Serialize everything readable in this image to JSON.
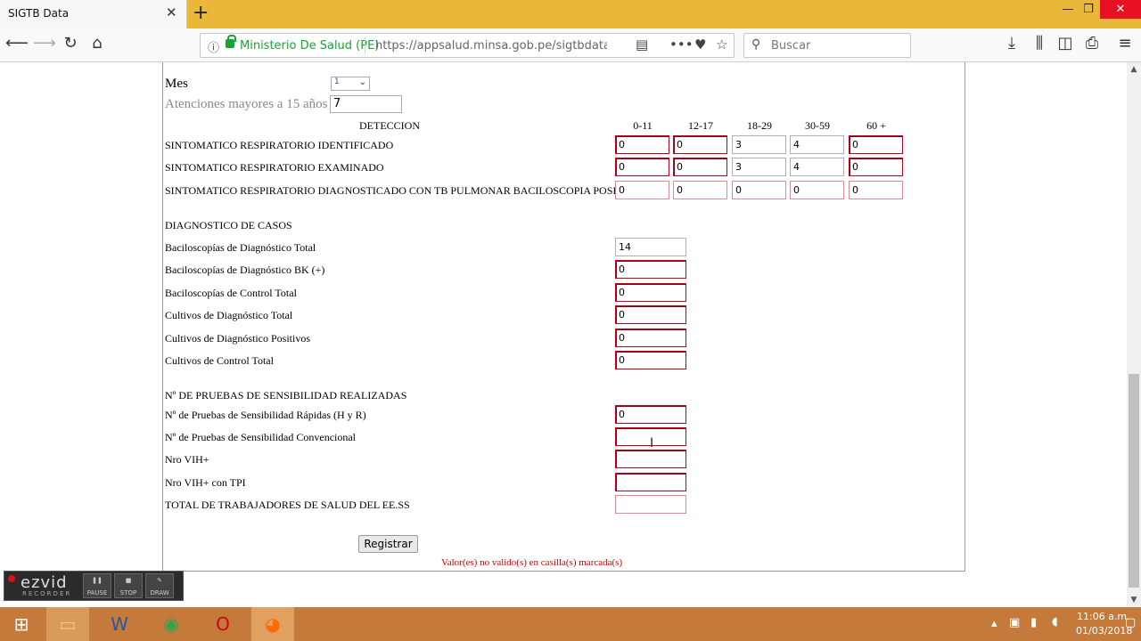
{
  "browser": {
    "tab_title": "SIGTB Data",
    "tab_close": "✕",
    "new_tab": "+",
    "site_owner": "Ministerio De Salud (PE)",
    "url": "https://appsalud.minsa.gob.pe/sigtbdata/TBC",
    "search_placeholder": "Buscar",
    "win_min": "—",
    "win_restore": "❐",
    "win_close": "✕",
    "accent_color": "#e9b83a"
  },
  "form": {
    "mes_label": "Mes",
    "mes_value": "1",
    "aten_label": "Atenciones mayores a 15 años",
    "aten_value": "7",
    "deteccion_header": "DETECCION",
    "age_columns": [
      "0-11",
      "12-17",
      "18-29",
      "30-59",
      "60 +"
    ],
    "rows": [
      {
        "label": "SINTOMATICO RESPIRATORIO IDENTIFICADO",
        "values": [
          "0",
          "0",
          "3",
          "4",
          "0"
        ]
      },
      {
        "label": "SINTOMATICO RESPIRATORIO EXAMINADO",
        "values": [
          "0",
          "0",
          "3",
          "4",
          "0"
        ]
      },
      {
        "label": "SINTOMATICO RESPIRATORIO DIAGNOSTICADO CON TB PULMONAR BACILOSCOPIA POSITIVA",
        "values": [
          "0",
          "0",
          "0",
          "0",
          "0"
        ]
      }
    ],
    "diag_header": "DIAGNOSTICO DE CASOS",
    "diag_rows": [
      {
        "label": "Baciloscopías de Diagnóstico Total",
        "value": "14"
      },
      {
        "label": "Baciloscopías de Diagnóstico BK (+)",
        "value": "0"
      },
      {
        "label": "Baciloscopías de Control Total",
        "value": "0"
      },
      {
        "label": "Cultivos de Diagnóstico Total",
        "value": "0"
      },
      {
        "label": "Cultivos de Diagnóstico Positivos",
        "value": "0"
      },
      {
        "label": "Cultivos de Control Total",
        "value": "0"
      }
    ],
    "sens_header": "Nº DE PRUEBAS DE SENSIBILIDAD REALIZADAS",
    "sens_rows": [
      {
        "label": "Nº de Pruebas de Sensibilidad Rápidas (H y R)",
        "value": "0"
      },
      {
        "label": "Nº de Pruebas de Sensibilidad Convencional",
        "value": ""
      },
      {
        "label": "Nro VIH+",
        "value": ""
      },
      {
        "label": "Nro VIH+ con TPI",
        "value": ""
      },
      {
        "label": "TOTAL DE TRABAJADORES DE SALUD DEL EE.SS",
        "value": ""
      }
    ],
    "submit_label": "Registrar",
    "error_message": "Valor(es) no valido(s) en casilla(s) marcada(s)",
    "error_color": "#d40000"
  },
  "ezvid": {
    "logo": "ezvid",
    "sub": "RECORDER",
    "pause": "PAUSE",
    "stop": "STOP",
    "draw": "DRAW"
  },
  "taskbar": {
    "time": "11:06 a.m.",
    "date": "01/03/2018"
  }
}
